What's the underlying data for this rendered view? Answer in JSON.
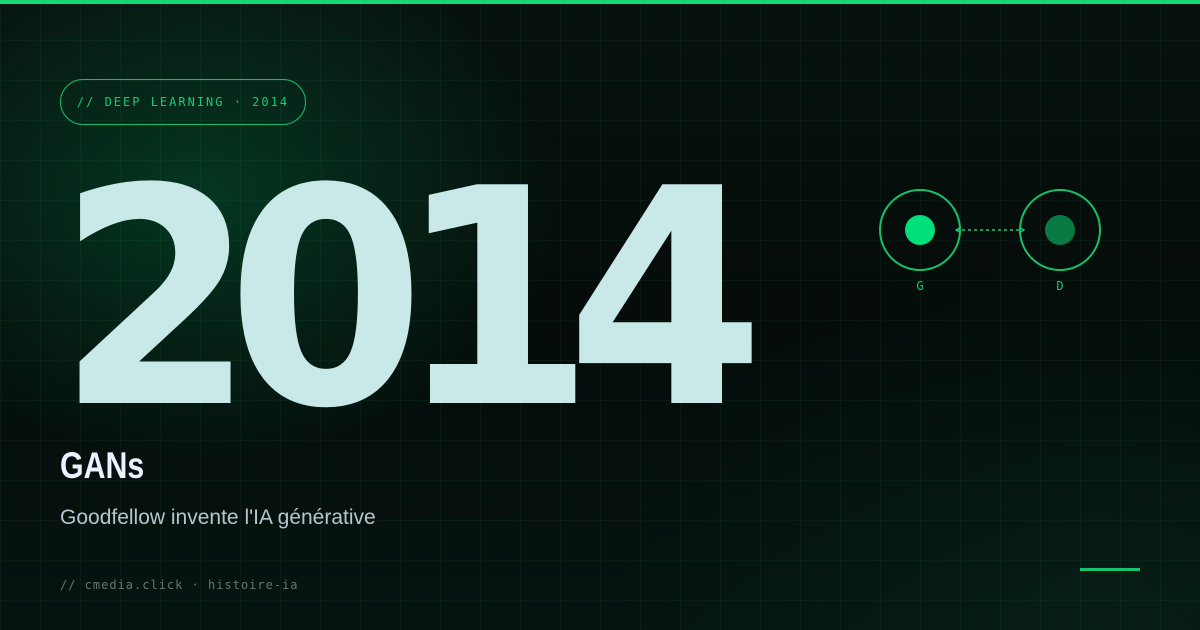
{
  "tag": "// DEEP LEARNING · 2014",
  "year": "2014",
  "title": "GANs",
  "subtitle": "Goodfellow invente l'IA générative",
  "footer": "// cmedia.click · histoire-ia",
  "diagram": {
    "generator_label": "G",
    "discriminator_label": "D"
  },
  "colors": {
    "accent": "#16d774",
    "year_text": "#c9e9e8",
    "background": "#07100d"
  }
}
